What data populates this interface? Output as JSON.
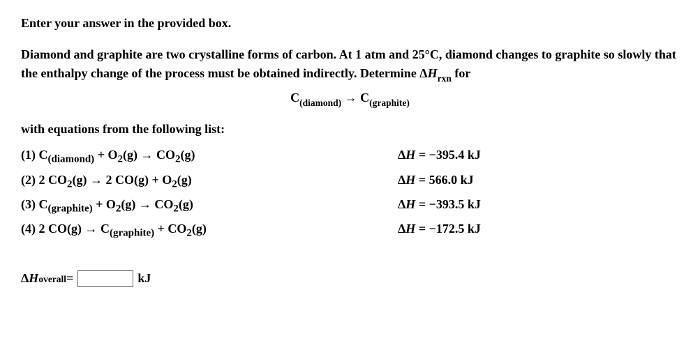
{
  "intro1": "Enter your answer in the provided box.",
  "intro2_part1": "Diamond and graphite are two crystalline forms of carbon. At 1 atm and 25°C, diamond changes to graphite so slowly that the enthalpy change of the process must be obtained indirectly. Determine Δ",
  "intro2_hlabel": "H",
  "intro2_hsub": "rxn",
  "intro2_part2": " for",
  "target_reaction": {
    "left_c": "C",
    "left_sub": "(diamond)",
    "arrow": " → ",
    "right_c": "C",
    "right_sub": "(graphite)"
  },
  "list_intro": "with equations from the following list:",
  "equations": [
    {
      "num": "(1) ",
      "lhs_html": "C<sub>(diamond)</sub> + O<sub>2</sub>(g) → CO<sub>2</sub>(g)",
      "dh": "ΔH = −395.4 kJ"
    },
    {
      "num": "(2) ",
      "lhs_html": "2 CO<sub>2</sub>(g) → 2 CO(g) + O<sub>2</sub>(g)",
      "dh": "ΔH = 566.0 kJ"
    },
    {
      "num": "(3) ",
      "lhs_html": "C<sub>(graphite)</sub> + O<sub>2</sub>(g) → CO<sub>2</sub>(g)",
      "dh": "ΔH = −393.5 kJ"
    },
    {
      "num": "(4) ",
      "lhs_html": "2 CO(g) → C<sub>(graphite)</sub> + CO<sub>2</sub>(g)",
      "dh": "ΔH = −172.5 kJ"
    }
  ],
  "answer": {
    "label_dh": "ΔH",
    "label_sub": "overall",
    "eq": " = ",
    "unit": " kJ"
  }
}
